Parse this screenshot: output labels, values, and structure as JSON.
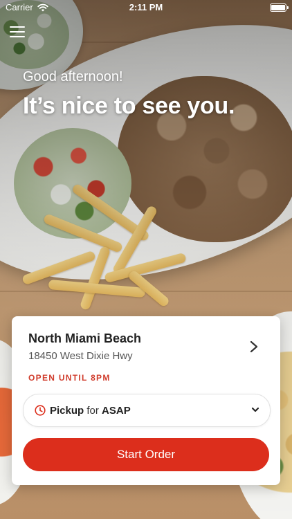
{
  "status_bar": {
    "carrier": "Carrier",
    "time": "2:11 PM"
  },
  "icons": {
    "menu": "hamburger-menu-icon",
    "wifi": "wifi-icon",
    "battery": "battery-icon",
    "chevron_right": "chevron-right-icon",
    "clock": "clock-icon",
    "chevron_down": "chevron-down-icon"
  },
  "hero": {
    "greeting": "Good afternoon!",
    "headline": "It’s nice to see you."
  },
  "store_card": {
    "name": "North Miami Beach",
    "address": "18450 West Dixie Hwy",
    "open_status": "OPEN UNTIL 8PM",
    "order_type": "Pickup",
    "for_label": "for",
    "time_option": "ASAP",
    "start_button_label": "Start Order"
  },
  "colors": {
    "accent": "#dc2e1c",
    "open_status": "#d03c2c",
    "text_primary": "#222222"
  }
}
